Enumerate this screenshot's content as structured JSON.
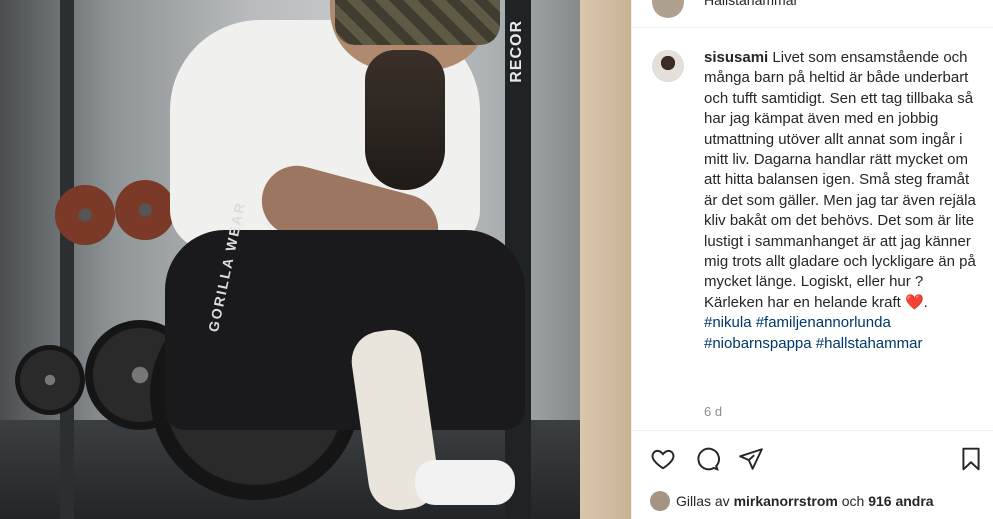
{
  "location": "Hallstahammar",
  "photo": {
    "rack_brand": "RECOR",
    "pants_print": "GORILLA WEAR"
  },
  "post": {
    "username": "sisusami",
    "caption": "Livet som ensamstående och många barn på heltid är både underbart och tufft samtidigt. Sen ett tag tillbaka så har jag kämpat även med en jobbig utmattning utöver allt annat som ingår i mitt liv. Dagarna handlar rätt mycket om att hitta balansen igen. Små steg framåt är det som gäller. Men jag tar även rejäla kliv bakåt om det behövs. Det som är lite lustigt i sammanhanget är att jag känner mig trots allt gladare och lyckligare än på mycket länge. Logiskt, eller hur ? Kärleken har en helande kraft",
    "heart": "❤️",
    "caption_end": ".",
    "hashtags_line1": "#nikula #familjenannorlunda",
    "hashtags_line2": "#niobarnspappa #hallstahammar",
    "time_ago": "6 d"
  },
  "likes": {
    "prefix": "Gillas av",
    "user": "mirkanorrstrom",
    "middle": "och",
    "count": "916 andra"
  },
  "icons": {
    "like": "heart-icon",
    "comment": "comment-icon",
    "share": "share-icon",
    "save": "bookmark-icon"
  }
}
